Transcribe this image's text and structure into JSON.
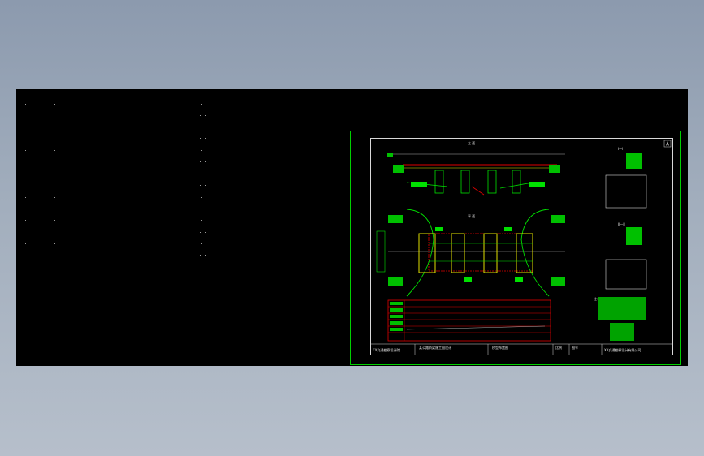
{
  "app": {
    "background": "#8c9aae",
    "viewport_bg": "#000000",
    "frame_color": "#00d000",
    "accent_red": "#e00000",
    "accent_yellow": "#e0e000",
    "accent_green": "#00e000"
  },
  "drawing": {
    "view_title_elevation": "立 面",
    "view_title_plan": "平 面",
    "section_1": "I—I",
    "section_2": "II—II",
    "notes_label": "注：",
    "title_block": {
      "company_left": "XX交通勘察设计院",
      "project": "某公路桥梁施工图设计",
      "drawing_name": "桥型布置图",
      "company_right": "XX交通勘察设计有限公司",
      "scale_label": "比例",
      "sheet_label": "图号"
    }
  },
  "icons": {
    "north_arrow": "north-arrow-icon"
  }
}
